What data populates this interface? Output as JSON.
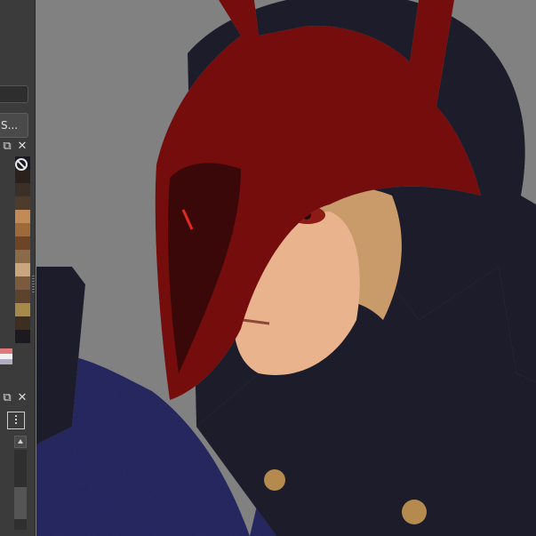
{
  "docker": {
    "preset_button_label": "S...",
    "palette_colors": [
      "#1a1822",
      "#2a211c",
      "#3a3028",
      "#4e3b2b",
      "#c18a56",
      "#9f6a3a",
      "#6d4424",
      "#8a6a48",
      "#c9a67d",
      "#7b5a3e",
      "#5b432e",
      "#a58a4a",
      "#3d2e22",
      "#1c1a20"
    ],
    "palette_small": [
      "#e07a7a",
      "#f2f2f2",
      "#b0aec0"
    ],
    "clear_icon_name": "no-entry-icon"
  },
  "canvas": {
    "colors": {
      "background": "#818181",
      "helmet_red": "#7a1210",
      "helmet_dark": "#3a0808",
      "coat_dark": "#1f1d2c",
      "coat_blue": "#272a63",
      "skin": "#e9b48d",
      "hair": "#c99a6a",
      "eye": "#8d1a14",
      "button": "#b48a4e"
    }
  }
}
